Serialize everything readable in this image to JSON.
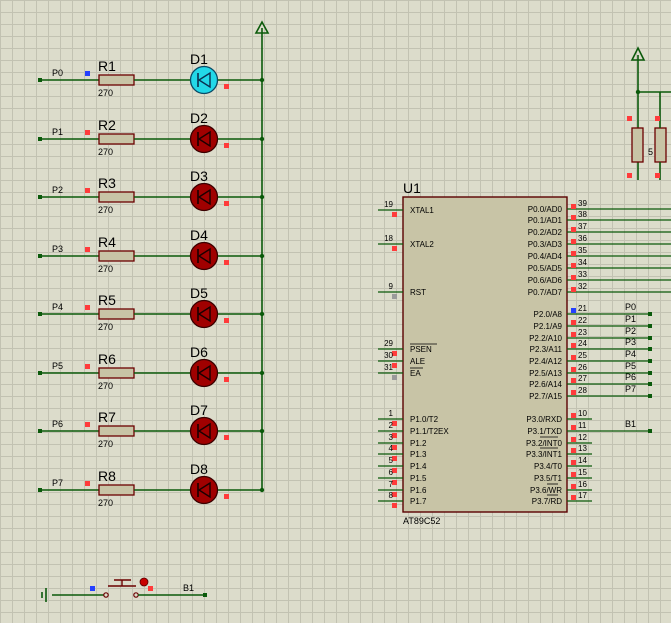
{
  "leds": [
    {
      "net": "P0",
      "resistor": "R1",
      "value": "270",
      "diode": "D1",
      "state": "on"
    },
    {
      "net": "P1",
      "resistor": "R2",
      "value": "270",
      "diode": "D2",
      "state": "off"
    },
    {
      "net": "P2",
      "resistor": "R3",
      "value": "270",
      "diode": "D3",
      "state": "off"
    },
    {
      "net": "P3",
      "resistor": "R4",
      "value": "270",
      "diode": "D4",
      "state": "off"
    },
    {
      "net": "P4",
      "resistor": "R5",
      "value": "270",
      "diode": "D5",
      "state": "off"
    },
    {
      "net": "P5",
      "resistor": "R6",
      "value": "270",
      "diode": "D6",
      "state": "off"
    },
    {
      "net": "P6",
      "resistor": "R7",
      "value": "270",
      "diode": "D7",
      "state": "off"
    },
    {
      "net": "P7",
      "resistor": "R8",
      "value": "270",
      "diode": "D8",
      "state": "off"
    }
  ],
  "mcu": {
    "ref": "U1",
    "part": "AT89C52",
    "left_pins": [
      {
        "num": "19",
        "name": "XTAL1"
      },
      {
        "num": "18",
        "name": "XTAL2"
      },
      {
        "num": "9",
        "name": "RST"
      },
      {
        "num": "29",
        "name": "PSEN"
      },
      {
        "num": "30",
        "name": "ALE"
      },
      {
        "num": "31",
        "name": "EA"
      },
      {
        "num": "1",
        "name": "P1.0/T2"
      },
      {
        "num": "2",
        "name": "P1.1/T2EX"
      },
      {
        "num": "3",
        "name": "P1.2"
      },
      {
        "num": "4",
        "name": "P1.3"
      },
      {
        "num": "5",
        "name": "P1.4"
      },
      {
        "num": "6",
        "name": "P1.5"
      },
      {
        "num": "7",
        "name": "P1.6"
      },
      {
        "num": "8",
        "name": "P1.7"
      }
    ],
    "p0_pins": [
      {
        "num": "39",
        "name": "P0.0/AD0"
      },
      {
        "num": "38",
        "name": "P0.1/AD1"
      },
      {
        "num": "37",
        "name": "P0.2/AD2"
      },
      {
        "num": "36",
        "name": "P0.3/AD3"
      },
      {
        "num": "35",
        "name": "P0.4/AD4"
      },
      {
        "num": "34",
        "name": "P0.5/AD5"
      },
      {
        "num": "33",
        "name": "P0.6/AD6"
      },
      {
        "num": "32",
        "name": "P0.7/AD7"
      }
    ],
    "p2_pins": [
      {
        "num": "21",
        "name": "P2.0/A8",
        "net": "P0"
      },
      {
        "num": "22",
        "name": "P2.1/A9",
        "net": "P1"
      },
      {
        "num": "23",
        "name": "P2.2/A10",
        "net": "P2"
      },
      {
        "num": "24",
        "name": "P2.3/A11",
        "net": "P3"
      },
      {
        "num": "25",
        "name": "P2.4/A12",
        "net": "P4"
      },
      {
        "num": "26",
        "name": "P2.5/A13",
        "net": "P5"
      },
      {
        "num": "27",
        "name": "P2.6/A14",
        "net": "P6"
      },
      {
        "num": "28",
        "name": "P2.7/A15",
        "net": "P7"
      }
    ],
    "p3_pins": [
      {
        "num": "10",
        "name": "P3.0/RXD",
        "net": ""
      },
      {
        "num": "11",
        "name": "P3.1/TXD",
        "net": "B1"
      },
      {
        "num": "12",
        "name": "P3.2/INT0",
        "net": ""
      },
      {
        "num": "13",
        "name": "P3.3/INT1",
        "net": ""
      },
      {
        "num": "14",
        "name": "P3.4/T0",
        "net": ""
      },
      {
        "num": "15",
        "name": "P3.5/T1",
        "net": ""
      },
      {
        "num": "16",
        "name": "P3.6/WR",
        "net": ""
      },
      {
        "num": "17",
        "name": "P3.7/RD",
        "net": ""
      }
    ]
  },
  "pullup_label": "5",
  "button": {
    "net": "B1"
  },
  "colors": {
    "wire": "#0b5a0b",
    "body": "#c8c4a6",
    "led_off": "#a00000",
    "led_on": "#22d8e8",
    "marker": "#ff3b3b",
    "blue_marker": "#2440ff",
    "outline": "#6b0000"
  }
}
